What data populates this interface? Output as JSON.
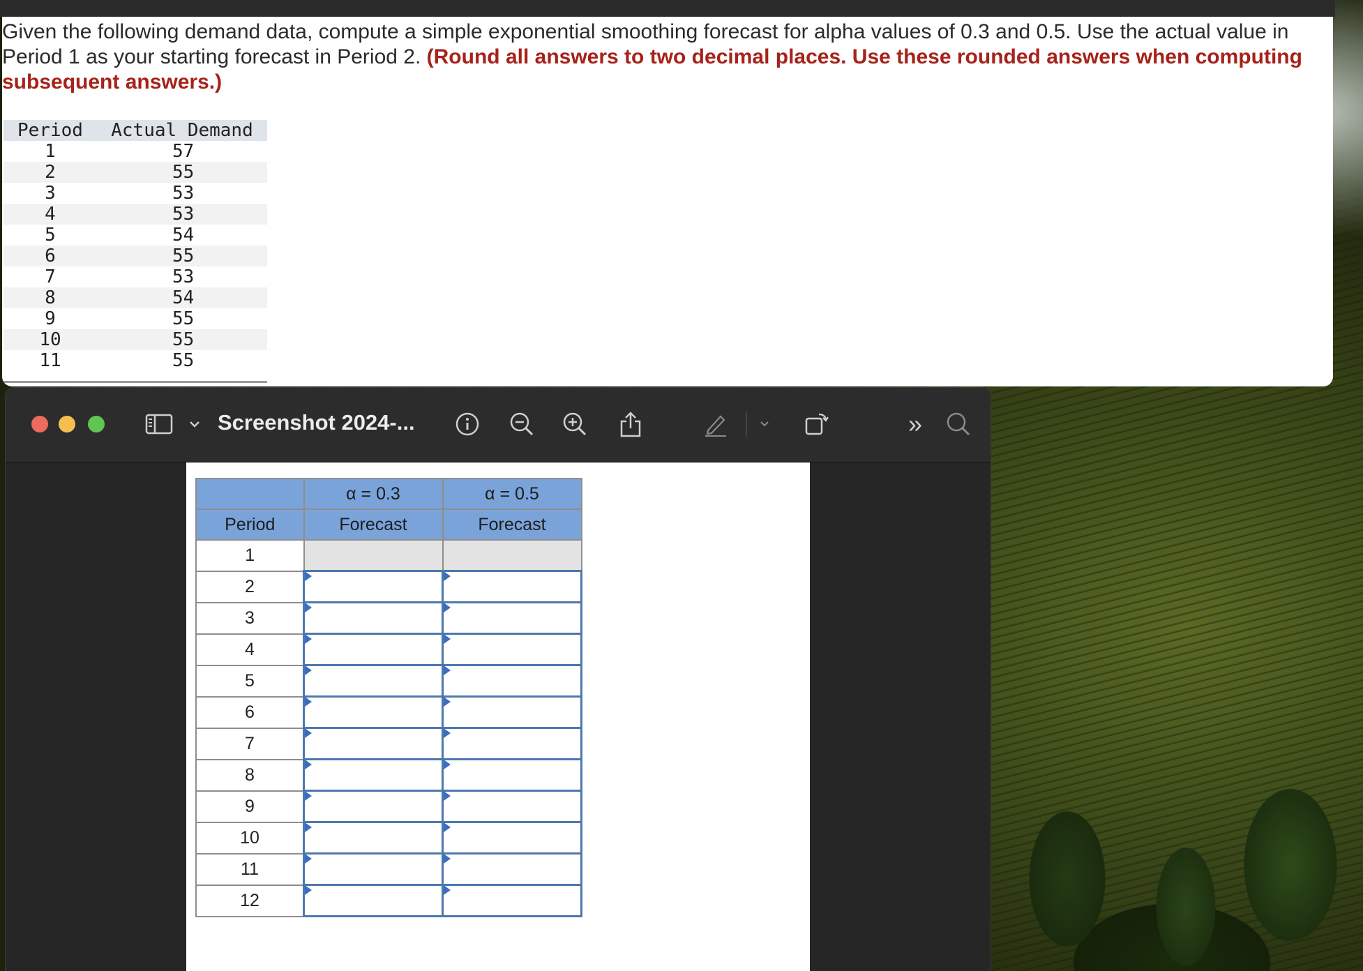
{
  "question": {
    "text": "Given the following demand data, compute a simple exponential smoothing forecast for alpha values of 0.3 and 0.5. Use the actual value in Period 1 as your starting forecast in Period 2.",
    "emphasis": "(Round all answers to two decimal places. Use these rounded answers when computing subsequent answers.)"
  },
  "demand_table": {
    "headers": [
      "Period",
      "Actual Demand"
    ],
    "rows": [
      [
        "1",
        "57"
      ],
      [
        "2",
        "55"
      ],
      [
        "3",
        "53"
      ],
      [
        "4",
        "53"
      ],
      [
        "5",
        "54"
      ],
      [
        "6",
        "55"
      ],
      [
        "7",
        "53"
      ],
      [
        "8",
        "54"
      ],
      [
        "9",
        "55"
      ],
      [
        "10",
        "55"
      ],
      [
        "11",
        "55"
      ]
    ]
  },
  "preview_window": {
    "title": "Screenshot 2024-...",
    "toolbar_icons": [
      "sidebar-icon",
      "chevron-down-icon",
      "info-icon",
      "zoom-out-icon",
      "zoom-in-icon",
      "share-icon",
      "markup-pen-icon",
      "chevron-down-icon",
      "rotate-icon",
      "more-icon",
      "search-icon"
    ]
  },
  "forecast_table": {
    "alpha_headers": [
      "α = 0.3",
      "α = 0.5"
    ],
    "period_header": "Period",
    "forecast_header": "Forecast",
    "periods": [
      "1",
      "2",
      "3",
      "4",
      "5",
      "6",
      "7",
      "8",
      "9",
      "10",
      "11",
      "12"
    ]
  },
  "colors": {
    "emphasis": "#a6221a",
    "table_header": "#7aa3da",
    "input_border": "#4c78ad"
  }
}
